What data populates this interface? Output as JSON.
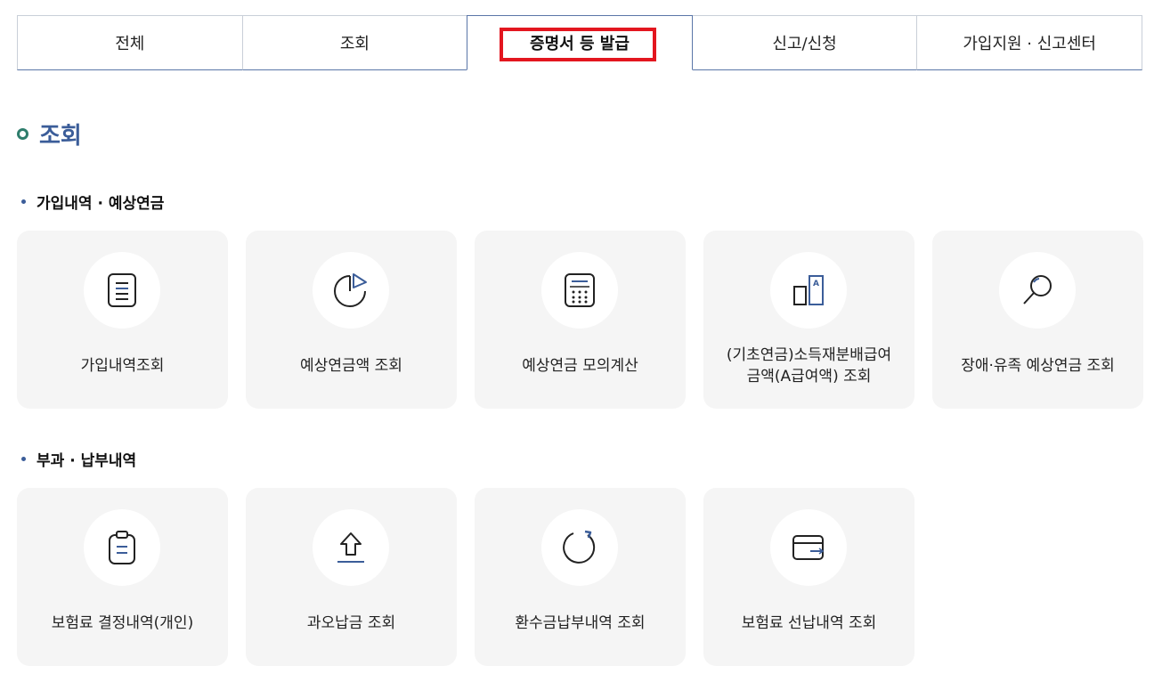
{
  "tabs": [
    {
      "label": "전체",
      "active": false
    },
    {
      "label": "조회",
      "active": false
    },
    {
      "label": "증명서 등 발급",
      "active": true
    },
    {
      "label": "신고/신청",
      "active": false
    },
    {
      "label": "가입지원 · 신고센터",
      "active": false
    }
  ],
  "section": {
    "title": "조회"
  },
  "groups": [
    {
      "title": "가입내역 · 예상연금",
      "cards": [
        {
          "label": "가입내역조회",
          "icon": "document-list-icon"
        },
        {
          "label": "예상연금액 조회",
          "icon": "pie-chart-icon"
        },
        {
          "label": "예상연금 모의계산",
          "icon": "calculator-icon"
        },
        {
          "label": "(기초연금)소득재분배급여\n금액(A급여액) 조회",
          "icon": "a-value-chart-icon",
          "icon_text": "A"
        },
        {
          "label": "장애·유족 예상연금 조회",
          "icon": "magnifier-icon"
        }
      ]
    },
    {
      "title": "부과 · 납부내역",
      "cards": [
        {
          "label": "보험료 결정내역(개인)",
          "icon": "clipboard-icon"
        },
        {
          "label": "과오납금 조회",
          "icon": "upload-arrow-icon"
        },
        {
          "label": "환수금납부내역 조회",
          "icon": "refresh-circle-icon"
        },
        {
          "label": "보험료 선납내역 조회",
          "icon": "wallet-icon"
        }
      ]
    }
  ],
  "colors": {
    "accent": "#3b5d99",
    "highlight": "#e3161f",
    "card_bg": "#f5f5f5"
  }
}
